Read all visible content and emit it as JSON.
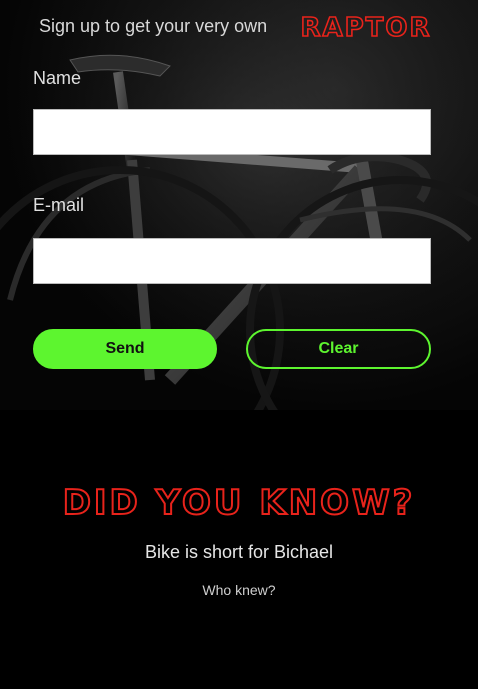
{
  "header": {
    "tagline": "Sign up to get your very own",
    "brand": "RAPTOR"
  },
  "form": {
    "name_label": "Name",
    "name_value": "",
    "email_label": "E-mail",
    "email_value": "",
    "send_label": "Send",
    "clear_label": "Clear"
  },
  "facts": {
    "heading": "DID YOU KNOW?",
    "fact": "Bike is short for Bichael",
    "aside": "Who knew?"
  },
  "colors": {
    "background": "#000000",
    "accent_green": "#5df52f",
    "heading_red": "#e8231b"
  }
}
